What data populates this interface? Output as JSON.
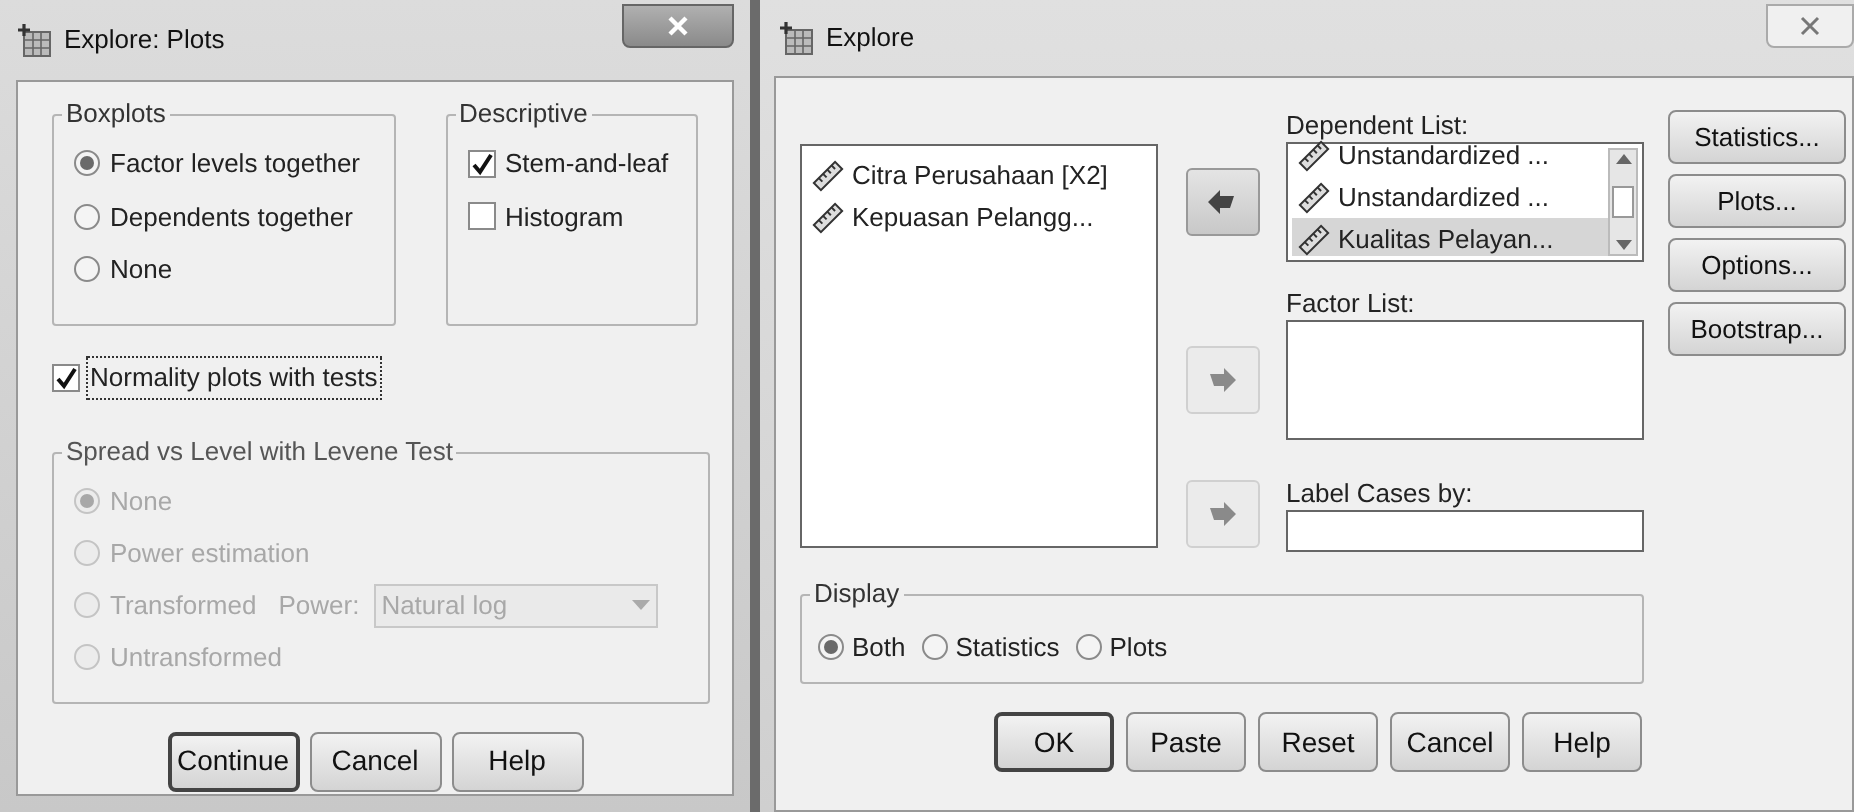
{
  "plots_window": {
    "title": "Explore: Plots",
    "boxplots": {
      "title": "Boxplots",
      "options": [
        {
          "label": "Factor levels together",
          "selected": true
        },
        {
          "label": "Dependents together",
          "selected": false
        },
        {
          "label": "None",
          "selected": false
        }
      ]
    },
    "descriptive": {
      "title": "Descriptive",
      "options": [
        {
          "label": "Stem-and-leaf",
          "checked": true
        },
        {
          "label": "Histogram",
          "checked": false
        }
      ]
    },
    "normality": {
      "label": "Normality plots with tests",
      "checked": true
    },
    "spread": {
      "title": "Spread vs Level with Levene Test",
      "disabled": true,
      "options": [
        {
          "label": "None",
          "selected": true
        },
        {
          "label": "Power estimation",
          "selected": false
        },
        {
          "label": "Transformed",
          "selected": false
        },
        {
          "label": "Untransformed",
          "selected": false
        }
      ],
      "power_label": "Power:",
      "power_value": "Natural log"
    },
    "buttons": [
      {
        "label": "Continue",
        "default": true
      },
      {
        "label": "Cancel",
        "default": false
      },
      {
        "label": "Help",
        "default": false
      }
    ]
  },
  "explore_window": {
    "title": "Explore",
    "source_variables": [
      "Citra Perusahaan [X2]",
      "Kepuasan Pelangg..."
    ],
    "arrow_buttons": [
      {
        "disabled": false
      },
      {
        "disabled": true
      },
      {
        "disabled": true
      }
    ],
    "dependent_list": {
      "label": "Dependent List:",
      "items": [
        {
          "label": "Unstandardized ...",
          "selected": false
        },
        {
          "label": "Unstandardized ...",
          "selected": false
        },
        {
          "label": "Kualitas Pelayan...",
          "selected": true
        }
      ]
    },
    "factor_list": {
      "label": "Factor List:"
    },
    "label_cases": {
      "label": "Label Cases by:"
    },
    "side_buttons": [
      "Statistics...",
      "Plots...",
      "Options...",
      "Bootstrap..."
    ],
    "display": {
      "title": "Display",
      "options": [
        {
          "label": "Both",
          "selected": true
        },
        {
          "label": "Statistics",
          "selected": false
        },
        {
          "label": "Plots",
          "selected": false
        }
      ]
    },
    "buttons": [
      {
        "label": "OK",
        "default": true
      },
      {
        "label": "Paste",
        "default": false
      },
      {
        "label": "Reset",
        "default": false
      },
      {
        "label": "Cancel",
        "default": false
      },
      {
        "label": "Help",
        "default": false
      }
    ]
  }
}
